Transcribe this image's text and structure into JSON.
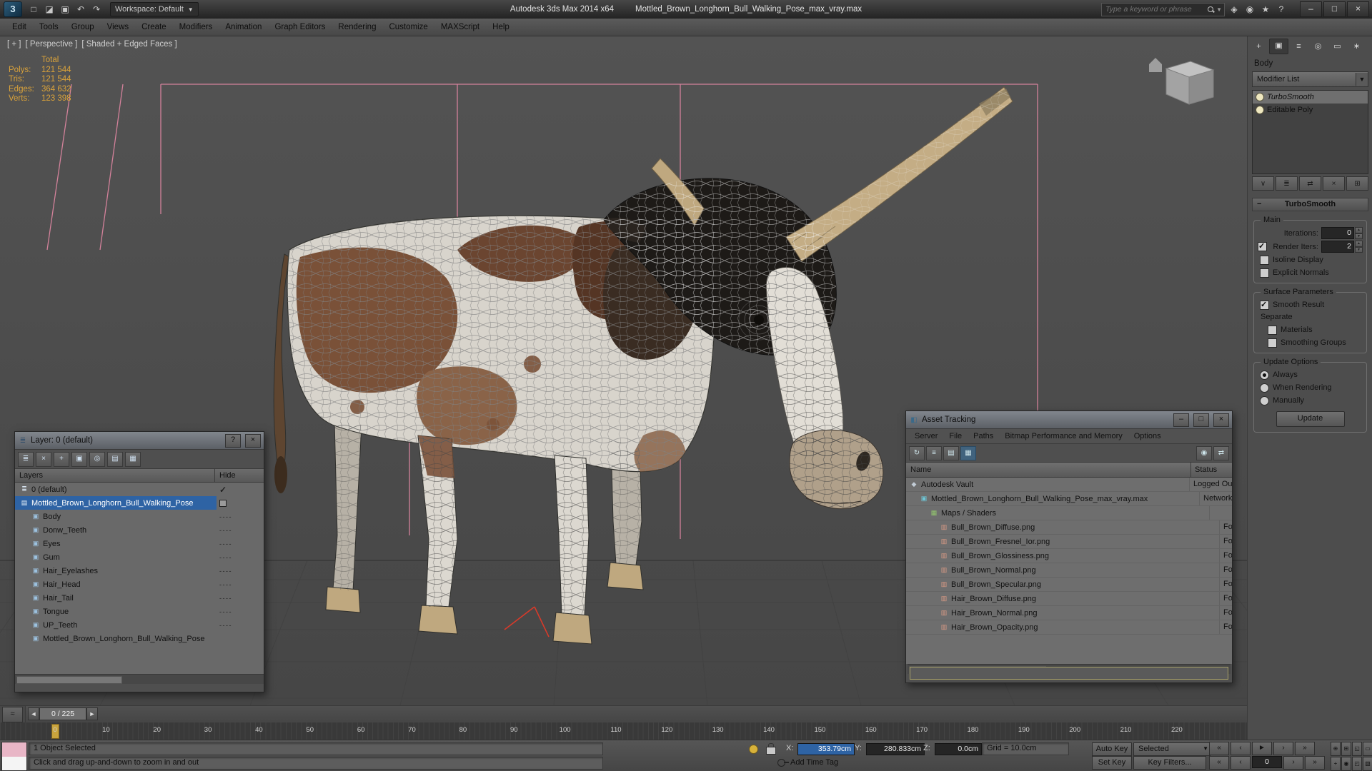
{
  "colors": {
    "selection_blue": "#2e63a4",
    "helper_pink": "#e287a3",
    "stats_amber": "#dba33a",
    "row_gray": "#6e6e6e"
  },
  "window": {
    "app_title": "Autodesk 3ds Max  2014 x64",
    "doc_title": "Mottled_Brown_Longhorn_Bull_Walking_Pose_max_vray.max",
    "workspace_label": "Workspace: Default",
    "search_placeholder": "Type a keyword or phrase",
    "logo_glyph": "3",
    "quick_icons": [
      {
        "name": "new-scene-icon",
        "glyph": "□"
      },
      {
        "name": "open-file-icon",
        "glyph": "◪"
      },
      {
        "name": "save-file-icon",
        "glyph": "▣"
      },
      {
        "name": "undo-icon",
        "glyph": "↶"
      },
      {
        "name": "redo-icon",
        "glyph": "↷"
      }
    ],
    "infocenter_icons": [
      {
        "name": "sign-in-icon",
        "glyph": "◈"
      },
      {
        "name": "communication-center-icon",
        "glyph": "◉"
      },
      {
        "name": "favorites-icon",
        "glyph": "★"
      },
      {
        "name": "help-icon",
        "glyph": "?"
      }
    ],
    "window_buttons": [
      {
        "name": "minimize-button",
        "glyph": "–"
      },
      {
        "name": "maximize-button",
        "glyph": "□"
      },
      {
        "name": "close-button",
        "glyph": "×"
      }
    ]
  },
  "menu_bar": {
    "items": [
      "Edit",
      "Tools",
      "Group",
      "Views",
      "Create",
      "Modifiers",
      "Animation",
      "Graph Editors",
      "Rendering",
      "Customize",
      "MAXScript",
      "Help"
    ]
  },
  "viewport": {
    "label_segments": [
      "[ + ]",
      "[ Perspective ]",
      "[ Shaded + Edged Faces ]"
    ],
    "stats": {
      "total_label": "Total",
      "rows": [
        {
          "label": "Polys:",
          "value": "121 544"
        },
        {
          "label": "Tris:",
          "value": "121 544"
        },
        {
          "label": "Edges:",
          "value": "364 632"
        },
        {
          "label": "Verts:",
          "value": "123 398"
        }
      ]
    }
  },
  "layer_dialog": {
    "title": "Layer: 0 (default)",
    "help_glyph": "?",
    "close_glyph": "×",
    "title_icon_glyph": "≣",
    "toolbar": [
      {
        "name": "new-layer-icon",
        "glyph": "≣"
      },
      {
        "name": "delete-layer-icon",
        "glyph": "×"
      },
      {
        "name": "add-selection-to-layer-icon",
        "glyph": "+"
      },
      {
        "name": "select-layer-objects-icon",
        "glyph": "▣"
      },
      {
        "name": "set-current-layer-icon",
        "glyph": "◎"
      },
      {
        "name": "hide-layer-icon",
        "glyph": "▤"
      },
      {
        "name": "freeze-layer-icon",
        "glyph": "▦"
      }
    ],
    "columns": [
      "Layers",
      "Hide"
    ],
    "icon_glyphs": {
      "layer-list-icon": "≣",
      "layer-icon": "▤",
      "object-icon": "▣"
    },
    "rows": [
      {
        "label": "0 (default)",
        "icon": "layer-list-icon",
        "indent": 0,
        "current": true
      },
      {
        "label": "Mottled_Brown_Longhorn_Bull_Walking_Pose",
        "icon": "layer-icon",
        "indent": 0,
        "selected": true,
        "box": true
      },
      {
        "label": "Body",
        "icon": "object-icon",
        "indent": 1,
        "dashes": true
      },
      {
        "label": "Donw_Teeth",
        "icon": "object-icon",
        "indent": 1,
        "dashes": true
      },
      {
        "label": "Eyes",
        "icon": "object-icon",
        "indent": 1,
        "dashes": true
      },
      {
        "label": "Gum",
        "icon": "object-icon",
        "indent": 1,
        "dashes": true
      },
      {
        "label": "Hair_Eyelashes",
        "icon": "object-icon",
        "indent": 1,
        "dashes": true
      },
      {
        "label": "Hair_Head",
        "icon": "object-icon",
        "indent": 1,
        "dashes": true
      },
      {
        "label": "Hair_Tail",
        "icon": "object-icon",
        "indent": 1,
        "dashes": true
      },
      {
        "label": "Tongue",
        "icon": "object-icon",
        "indent": 1,
        "dashes": true
      },
      {
        "label": "UP_Teeth",
        "icon": "object-icon",
        "indent": 1,
        "dashes": true
      },
      {
        "label": "Mottled_Brown_Longhorn_Bull_Walking_Pose",
        "icon": "object-icon",
        "indent": 1,
        "dashes": false
      }
    ]
  },
  "asset_tracking": {
    "title": "Asset Tracking",
    "title_icon_glyph": "◧",
    "menu": [
      "Server",
      "File",
      "Paths",
      "Bitmap Performance and Memory",
      "Options"
    ],
    "toolbar": [
      {
        "name": "refresh-icon",
        "glyph": "↻"
      },
      {
        "name": "details-view-icon",
        "glyph": "≡"
      },
      {
        "name": "table-view-icon",
        "glyph": "▤"
      },
      {
        "name": "thumbnail-view-icon",
        "glyph": "▦",
        "active": true
      }
    ],
    "toolbar_right": [
      {
        "name": "network-paths-icon",
        "glyph": "◉"
      },
      {
        "name": "set-path-icon",
        "glyph": "⇄"
      }
    ],
    "columns": [
      "Name",
      "Status"
    ],
    "icon_glyphs": {
      "vault-icon": "◆",
      "max-file-icon": "▣",
      "maps-icon": "▦",
      "bitmap-icon": "▥"
    },
    "rows": [
      {
        "name": "Autodesk Vault",
        "status": "Logged Ou",
        "indent": 0,
        "icon": "vault-icon"
      },
      {
        "name": "Mottled_Brown_Longhorn_Bull_Walking_Pose_max_vray.max",
        "status": "Network P",
        "indent": 1,
        "icon": "max-file-icon"
      },
      {
        "name": "Maps / Shaders",
        "status": "",
        "indent": 2,
        "icon": "maps-icon"
      },
      {
        "name": "Bull_Brown_Diffuse.png",
        "status": "Found",
        "indent": 3,
        "icon": "bitmap-icon"
      },
      {
        "name": "Bull_Brown_Fresnel_Ior.png",
        "status": "Found",
        "indent": 3,
        "icon": "bitmap-icon"
      },
      {
        "name": "Bull_Brown_Glossiness.png",
        "status": "Found",
        "indent": 3,
        "icon": "bitmap-icon"
      },
      {
        "name": "Bull_Brown_Normal.png",
        "status": "Found",
        "indent": 3,
        "icon": "bitmap-icon"
      },
      {
        "name": "Bull_Brown_Specular.png",
        "status": "Found",
        "indent": 3,
        "icon": "bitmap-icon"
      },
      {
        "name": "Hair_Brown_Diffuse.png",
        "status": "Found",
        "indent": 3,
        "icon": "bitmap-icon"
      },
      {
        "name": "Hair_Brown_Normal.png",
        "status": "Found",
        "indent": 3,
        "icon": "bitmap-icon"
      },
      {
        "name": "Hair_Brown_Opacity.png",
        "status": "Found",
        "indent": 3,
        "icon": "bitmap-icon"
      }
    ]
  },
  "command_panel": {
    "tabs": [
      {
        "name": "create-tab",
        "glyph": "+"
      },
      {
        "name": "modify-tab",
        "glyph": "▣",
        "active": true
      },
      {
        "name": "hierarchy-tab",
        "glyph": "≡"
      },
      {
        "name": "motion-tab",
        "glyph": "◎"
      },
      {
        "name": "display-tab",
        "glyph": "▭"
      },
      {
        "name": "utilities-tab",
        "glyph": "∗"
      }
    ],
    "object_name": "Body",
    "modifier_list_label": "Modifier List",
    "stack": [
      {
        "label": "TurboSmooth",
        "selected": true,
        "italic": true
      },
      {
        "label": "Editable Poly",
        "selected": false,
        "italic": false
      }
    ],
    "stack_buttons": [
      {
        "name": "pin-stack-icon",
        "glyph": "∨"
      },
      {
        "name": "show-end-result-icon",
        "glyph": "≣"
      },
      {
        "name": "make-unique-icon",
        "glyph": "⇄"
      },
      {
        "name": "remove-modifier-icon",
        "glyph": "×"
      },
      {
        "name": "configure-modifier-sets-icon",
        "glyph": "⊞"
      }
    ],
    "rollout_title": "TurboSmooth",
    "main": {
      "title": "Main",
      "iterations_label": "Iterations:",
      "iterations_value": "0",
      "render_label": "Render Iters:",
      "render_value": "2",
      "render_checked": true,
      "isoline_label": "Isoline Display",
      "isoline_checked": false,
      "explicit_label": "Explicit Normals",
      "explicit_checked": false
    },
    "surface": {
      "title": "Surface Parameters",
      "smooth_label": "Smooth Result",
      "smooth_checked": true,
      "separate_label": "Separate",
      "materials_label": "Materials",
      "materials_checked": false,
      "groups_label": "Smoothing Groups",
      "groups_checked": false
    },
    "update": {
      "title": "Update Options",
      "options": [
        "Always",
        "When Rendering",
        "Manually"
      ],
      "selected_index": 0,
      "button_label": "Update"
    }
  },
  "timeline": {
    "curve_editor_glyph": "≈",
    "slider_prev_glyph": "◄",
    "slider_next_glyph": "►",
    "slider_label": "0 / 225",
    "ticks": [
      "0",
      "10",
      "20",
      "30",
      "40",
      "50",
      "60",
      "70",
      "80",
      "90",
      "100",
      "110",
      "120",
      "130",
      "140",
      "150",
      "160",
      "170",
      "180",
      "190",
      "200",
      "210",
      "220"
    ]
  },
  "status_bar": {
    "selection_text": "1 Object Selected",
    "prompt_text": "Click and drag up-and-down to zoom in and out",
    "add_time_tag": "Add Time Tag",
    "x_label": "X:",
    "x_value": "353.79cm",
    "y_label": "Y:",
    "y_value": "280.833cm",
    "z_label": "Z:",
    "z_value": "0.0cm",
    "grid_text": "Grid = 10.0cm",
    "auto_key": "Auto Key",
    "set_key": "Set Key",
    "selected_set": "Selected",
    "key_filters": "Key Filters...",
    "frame_value": "0",
    "transport_row1": [
      {
        "name": "go-to-start-button",
        "glyph": "«"
      },
      {
        "name": "previous-frame-button",
        "glyph": "‹"
      },
      {
        "name": "play-button",
        "glyph": "►"
      },
      {
        "name": "next-frame-button",
        "glyph": "›"
      },
      {
        "name": "go-to-end-button",
        "glyph": "»"
      }
    ],
    "transport_row2_left": [
      {
        "name": "key-mode-toggle-button",
        "glyph": "«"
      },
      {
        "name": "previous-key-button",
        "glyph": "‹"
      }
    ],
    "transport_row2_right": [
      {
        "name": "next-key-button",
        "glyph": "›"
      },
      {
        "name": "go-to-end-key-button",
        "glyph": "»"
      }
    ],
    "nav_row1": [
      {
        "name": "zoom-icon",
        "glyph": "⊕"
      },
      {
        "name": "zoom-all-icon",
        "glyph": "⊞"
      },
      {
        "name": "zoom-extents-icon",
        "glyph": "◱"
      },
      {
        "name": "zoom-region-icon",
        "glyph": "▭"
      }
    ],
    "nav_row2": [
      {
        "name": "pan-icon",
        "glyph": "+"
      },
      {
        "name": "orbit-icon",
        "glyph": "◉"
      },
      {
        "name": "maximize-viewport-toggle-icon",
        "glyph": "◰"
      },
      {
        "name": "field-of-view-icon",
        "glyph": "▧"
      }
    ]
  }
}
